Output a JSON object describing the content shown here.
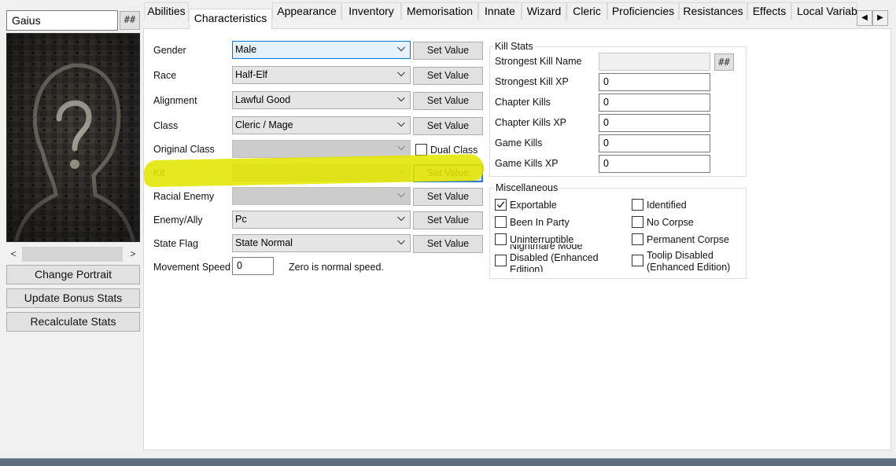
{
  "character": {
    "name": "Gaius",
    "hash_label": "##"
  },
  "portrait": {
    "scroll_left": "<",
    "scroll_right": ">"
  },
  "left_buttons": {
    "change_portrait": "Change Portrait",
    "update_bonus_stats": "Update Bonus Stats",
    "recalculate_stats": "Recalculate Stats"
  },
  "tabs": [
    {
      "label": "Abilities"
    },
    {
      "label": "Characteristics"
    },
    {
      "label": "Appearance"
    },
    {
      "label": "Inventory"
    },
    {
      "label": "Memorisation"
    },
    {
      "label": "Innate"
    },
    {
      "label": "Wizard"
    },
    {
      "label": "Cleric"
    },
    {
      "label": "Proficiencies"
    },
    {
      "label": "Resistances"
    },
    {
      "label": "Effects"
    },
    {
      "label": "Local Variab"
    }
  ],
  "active_tab": "Characteristics",
  "tab_scroll": {
    "left": "◀",
    "right": "▶"
  },
  "characteristics": {
    "set_value_label": "Set Value",
    "rows": [
      {
        "label": "Gender",
        "value": "Male"
      },
      {
        "label": "Race",
        "value": "Half-Elf"
      },
      {
        "label": "Alignment",
        "value": "Lawful Good"
      },
      {
        "label": "Class",
        "value": "Cleric / Mage"
      },
      {
        "label": "Original Class",
        "value": ""
      },
      {
        "label": "Kit",
        "value": ""
      },
      {
        "label": "Racial Enemy",
        "value": ""
      },
      {
        "label": "Enemy/Ally",
        "value": "Pc"
      },
      {
        "label": "State Flag",
        "value": "State Normal"
      }
    ],
    "dual_class_label": "Dual Class",
    "dual_class_checked": false,
    "movement_speed_label": "Movement Speed",
    "movement_speed_value": "0",
    "movement_speed_note": "Zero is normal speed."
  },
  "kill_stats": {
    "title": "Kill Stats",
    "strongest_kill_name_label": "Strongest Kill Name",
    "strongest_kill_name_value": "",
    "hash_label": "##",
    "fields": [
      {
        "label": "Strongest Kill XP",
        "value": "0"
      },
      {
        "label": "Chapter Kills",
        "value": "0"
      },
      {
        "label": "Chapter Kills XP",
        "value": "0"
      },
      {
        "label": "Game Kills",
        "value": "0"
      },
      {
        "label": "Game Kills XP",
        "value": "0"
      }
    ]
  },
  "miscellaneous": {
    "title": "Miscellaneous",
    "left": [
      {
        "label": "Exportable",
        "checked": true
      },
      {
        "label": "Been In Party",
        "checked": false
      },
      {
        "label": "Uninterruptible",
        "checked": false
      },
      {
        "label": "Nightmare Mode Disabled (Enhanced Edition)",
        "checked": false
      }
    ],
    "right": [
      {
        "label": "Identified",
        "checked": false
      },
      {
        "label": "No Corpse",
        "checked": false
      },
      {
        "label": "Permanent Corpse",
        "checked": false
      },
      {
        "label": "Toolip Disabled (Enhanced Edition)",
        "checked": false
      }
    ]
  },
  "colors": {
    "highlight": "#e2e600",
    "focus_border": "#0078d7",
    "button_bg": "#e1e1e1"
  }
}
